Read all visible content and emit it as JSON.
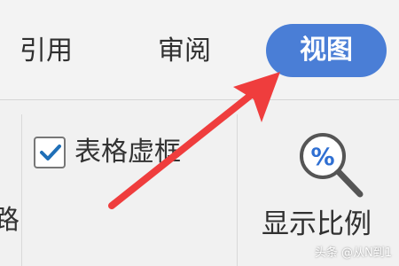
{
  "tabs": {
    "reference": "引用",
    "review": "审阅",
    "view": "视图",
    "active_color": "#4a7ed6"
  },
  "ribbon": {
    "cut_text": "路",
    "table_gridlines": {
      "label": "表格虚框",
      "checked": true
    },
    "zoom": {
      "label": "显示比例",
      "icon_text": "%",
      "icon": "magnifier-percent-icon"
    }
  },
  "annotation": {
    "arrow_color": "#ef3d3d"
  },
  "watermark": "头条 @从N到1"
}
